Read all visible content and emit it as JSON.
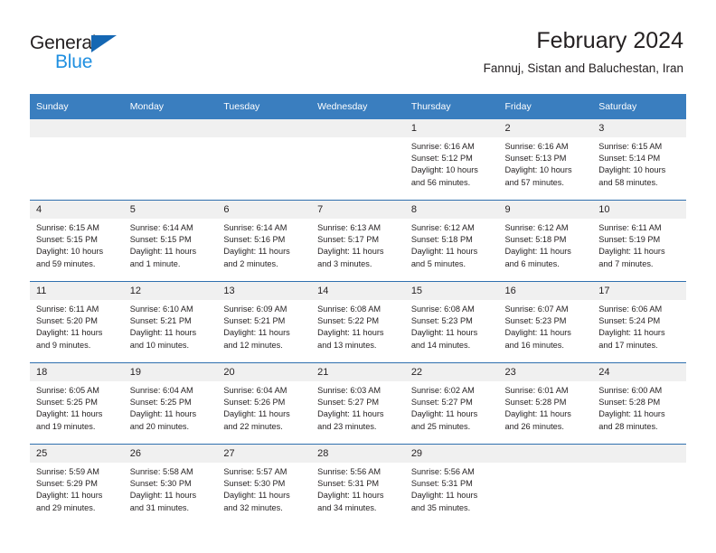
{
  "logo": {
    "word_top": "General",
    "word_bottom": "Blue",
    "triangle_color": "#1567b3",
    "blue_color": "#1f8fe0"
  },
  "header": {
    "title": "February 2024",
    "subtitle": "Fannuj, Sistan and Baluchestan, Iran"
  },
  "theme": {
    "header_bg": "#3a7ebf",
    "header_text": "#ffffff",
    "daynum_bg": "#f0f0f0",
    "row_divider": "#2f6fae",
    "text": "#231f20"
  },
  "weekdays": [
    "Sunday",
    "Monday",
    "Tuesday",
    "Wednesday",
    "Thursday",
    "Friday",
    "Saturday"
  ],
  "labels": {
    "sunrise": "Sunrise:",
    "sunset": "Sunset:",
    "daylight": "Daylight:"
  },
  "weeks": [
    [
      {
        "day": "",
        "l1": "",
        "l2": "",
        "l3": "",
        "l4": ""
      },
      {
        "day": "",
        "l1": "",
        "l2": "",
        "l3": "",
        "l4": ""
      },
      {
        "day": "",
        "l1": "",
        "l2": "",
        "l3": "",
        "l4": ""
      },
      {
        "day": "",
        "l1": "",
        "l2": "",
        "l3": "",
        "l4": ""
      },
      {
        "day": "1",
        "l1": "Sunrise: 6:16 AM",
        "l2": "Sunset: 5:12 PM",
        "l3": "Daylight: 10 hours",
        "l4": "and 56 minutes."
      },
      {
        "day": "2",
        "l1": "Sunrise: 6:16 AM",
        "l2": "Sunset: 5:13 PM",
        "l3": "Daylight: 10 hours",
        "l4": "and 57 minutes."
      },
      {
        "day": "3",
        "l1": "Sunrise: 6:15 AM",
        "l2": "Sunset: 5:14 PM",
        "l3": "Daylight: 10 hours",
        "l4": "and 58 minutes."
      }
    ],
    [
      {
        "day": "4",
        "l1": "Sunrise: 6:15 AM",
        "l2": "Sunset: 5:15 PM",
        "l3": "Daylight: 10 hours",
        "l4": "and 59 minutes."
      },
      {
        "day": "5",
        "l1": "Sunrise: 6:14 AM",
        "l2": "Sunset: 5:15 PM",
        "l3": "Daylight: 11 hours",
        "l4": "and 1 minute."
      },
      {
        "day": "6",
        "l1": "Sunrise: 6:14 AM",
        "l2": "Sunset: 5:16 PM",
        "l3": "Daylight: 11 hours",
        "l4": "and 2 minutes."
      },
      {
        "day": "7",
        "l1": "Sunrise: 6:13 AM",
        "l2": "Sunset: 5:17 PM",
        "l3": "Daylight: 11 hours",
        "l4": "and 3 minutes."
      },
      {
        "day": "8",
        "l1": "Sunrise: 6:12 AM",
        "l2": "Sunset: 5:18 PM",
        "l3": "Daylight: 11 hours",
        "l4": "and 5 minutes."
      },
      {
        "day": "9",
        "l1": "Sunrise: 6:12 AM",
        "l2": "Sunset: 5:18 PM",
        "l3": "Daylight: 11 hours",
        "l4": "and 6 minutes."
      },
      {
        "day": "10",
        "l1": "Sunrise: 6:11 AM",
        "l2": "Sunset: 5:19 PM",
        "l3": "Daylight: 11 hours",
        "l4": "and 7 minutes."
      }
    ],
    [
      {
        "day": "11",
        "l1": "Sunrise: 6:11 AM",
        "l2": "Sunset: 5:20 PM",
        "l3": "Daylight: 11 hours",
        "l4": "and 9 minutes."
      },
      {
        "day": "12",
        "l1": "Sunrise: 6:10 AM",
        "l2": "Sunset: 5:21 PM",
        "l3": "Daylight: 11 hours",
        "l4": "and 10 minutes."
      },
      {
        "day": "13",
        "l1": "Sunrise: 6:09 AM",
        "l2": "Sunset: 5:21 PM",
        "l3": "Daylight: 11 hours",
        "l4": "and 12 minutes."
      },
      {
        "day": "14",
        "l1": "Sunrise: 6:08 AM",
        "l2": "Sunset: 5:22 PM",
        "l3": "Daylight: 11 hours",
        "l4": "and 13 minutes."
      },
      {
        "day": "15",
        "l1": "Sunrise: 6:08 AM",
        "l2": "Sunset: 5:23 PM",
        "l3": "Daylight: 11 hours",
        "l4": "and 14 minutes."
      },
      {
        "day": "16",
        "l1": "Sunrise: 6:07 AM",
        "l2": "Sunset: 5:23 PM",
        "l3": "Daylight: 11 hours",
        "l4": "and 16 minutes."
      },
      {
        "day": "17",
        "l1": "Sunrise: 6:06 AM",
        "l2": "Sunset: 5:24 PM",
        "l3": "Daylight: 11 hours",
        "l4": "and 17 minutes."
      }
    ],
    [
      {
        "day": "18",
        "l1": "Sunrise: 6:05 AM",
        "l2": "Sunset: 5:25 PM",
        "l3": "Daylight: 11 hours",
        "l4": "and 19 minutes."
      },
      {
        "day": "19",
        "l1": "Sunrise: 6:04 AM",
        "l2": "Sunset: 5:25 PM",
        "l3": "Daylight: 11 hours",
        "l4": "and 20 minutes."
      },
      {
        "day": "20",
        "l1": "Sunrise: 6:04 AM",
        "l2": "Sunset: 5:26 PM",
        "l3": "Daylight: 11 hours",
        "l4": "and 22 minutes."
      },
      {
        "day": "21",
        "l1": "Sunrise: 6:03 AM",
        "l2": "Sunset: 5:27 PM",
        "l3": "Daylight: 11 hours",
        "l4": "and 23 minutes."
      },
      {
        "day": "22",
        "l1": "Sunrise: 6:02 AM",
        "l2": "Sunset: 5:27 PM",
        "l3": "Daylight: 11 hours",
        "l4": "and 25 minutes."
      },
      {
        "day": "23",
        "l1": "Sunrise: 6:01 AM",
        "l2": "Sunset: 5:28 PM",
        "l3": "Daylight: 11 hours",
        "l4": "and 26 minutes."
      },
      {
        "day": "24",
        "l1": "Sunrise: 6:00 AM",
        "l2": "Sunset: 5:28 PM",
        "l3": "Daylight: 11 hours",
        "l4": "and 28 minutes."
      }
    ],
    [
      {
        "day": "25",
        "l1": "Sunrise: 5:59 AM",
        "l2": "Sunset: 5:29 PM",
        "l3": "Daylight: 11 hours",
        "l4": "and 29 minutes."
      },
      {
        "day": "26",
        "l1": "Sunrise: 5:58 AM",
        "l2": "Sunset: 5:30 PM",
        "l3": "Daylight: 11 hours",
        "l4": "and 31 minutes."
      },
      {
        "day": "27",
        "l1": "Sunrise: 5:57 AM",
        "l2": "Sunset: 5:30 PM",
        "l3": "Daylight: 11 hours",
        "l4": "and 32 minutes."
      },
      {
        "day": "28",
        "l1": "Sunrise: 5:56 AM",
        "l2": "Sunset: 5:31 PM",
        "l3": "Daylight: 11 hours",
        "l4": "and 34 minutes."
      },
      {
        "day": "29",
        "l1": "Sunrise: 5:56 AM",
        "l2": "Sunset: 5:31 PM",
        "l3": "Daylight: 11 hours",
        "l4": "and 35 minutes."
      },
      {
        "day": "",
        "l1": "",
        "l2": "",
        "l3": "",
        "l4": ""
      },
      {
        "day": "",
        "l1": "",
        "l2": "",
        "l3": "",
        "l4": ""
      }
    ]
  ]
}
